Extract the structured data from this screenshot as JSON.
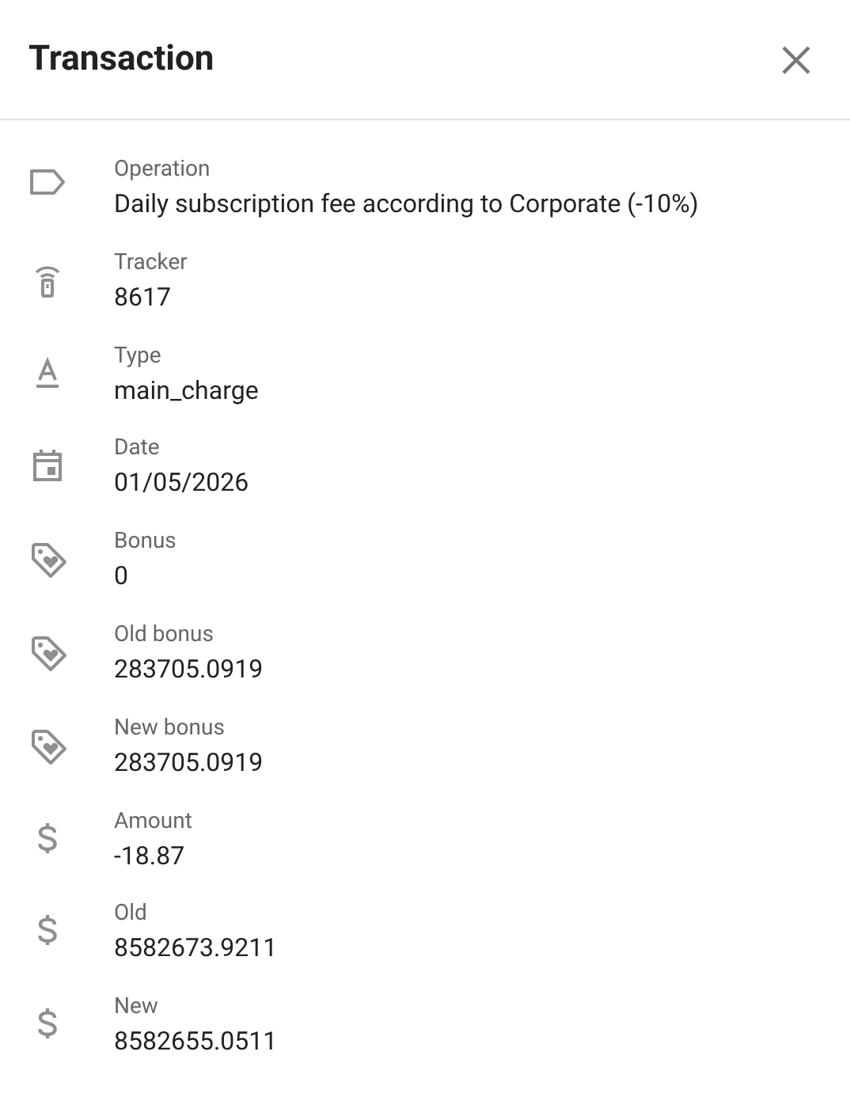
{
  "title": "Transaction",
  "fields": [
    {
      "kind": "label",
      "label": "Operation",
      "value": "Daily subscription fee according to Corporate (-10%)"
    },
    {
      "kind": "tracker",
      "label": "Tracker",
      "value": "8617"
    },
    {
      "kind": "text",
      "label": "Type",
      "value": "main_charge"
    },
    {
      "kind": "date",
      "label": "Date",
      "value": "01/05/2026"
    },
    {
      "kind": "bonus",
      "label": "Bonus",
      "value": "0"
    },
    {
      "kind": "bonus",
      "label": "Old bonus",
      "value": "283705.0919"
    },
    {
      "kind": "bonus",
      "label": "New bonus",
      "value": "283705.0919"
    },
    {
      "kind": "money",
      "label": "Amount",
      "value": "-18.87"
    },
    {
      "kind": "money",
      "label": "Old",
      "value": "8582673.9211"
    },
    {
      "kind": "money",
      "label": "New",
      "value": "8582655.0511"
    }
  ]
}
